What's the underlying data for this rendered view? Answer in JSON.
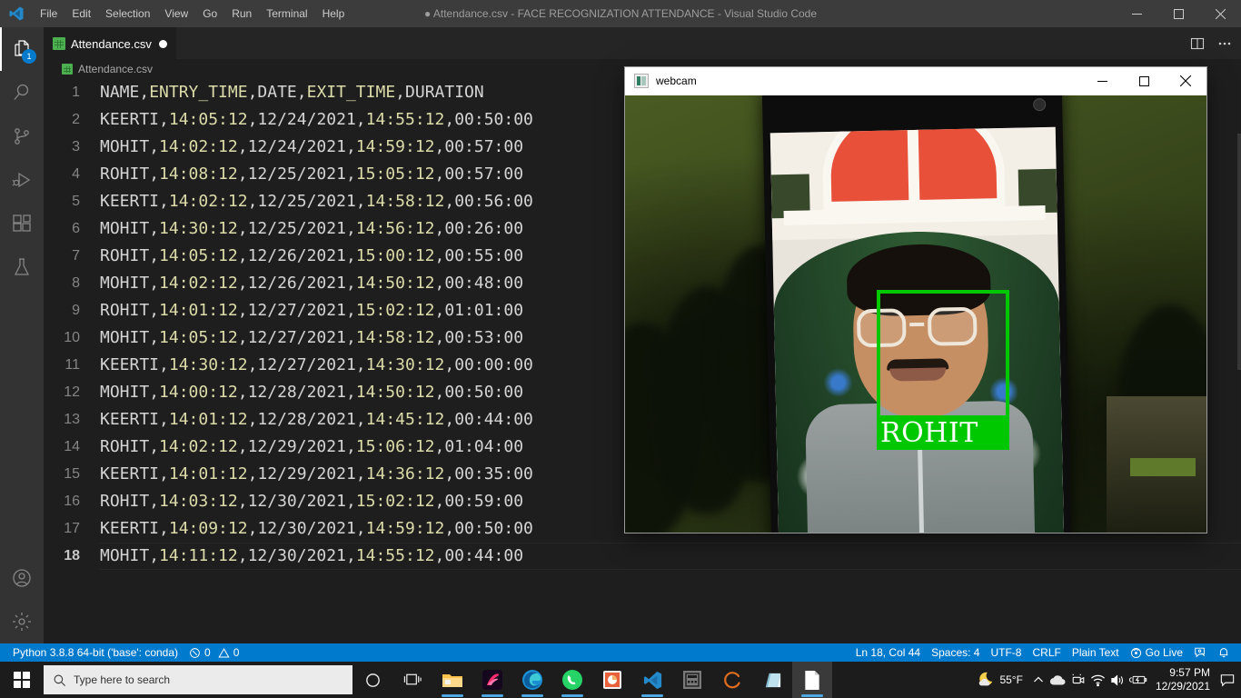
{
  "window": {
    "title": "● Attendance.csv - FACE RECOGNIZATION ATTENDANCE - Visual Studio Code",
    "minimize_label": "—",
    "maximize_label": "▢",
    "close_label": "✕"
  },
  "menubar": {
    "items": [
      "File",
      "Edit",
      "Selection",
      "View",
      "Go",
      "Run",
      "Terminal",
      "Help"
    ]
  },
  "activitybar": {
    "items": [
      {
        "name": "explorer",
        "badge": "1"
      },
      {
        "name": "search",
        "badge": ""
      },
      {
        "name": "source-control",
        "badge": ""
      },
      {
        "name": "run-and-debug",
        "badge": ""
      },
      {
        "name": "extensions",
        "badge": ""
      },
      {
        "name": "testing",
        "badge": ""
      }
    ],
    "bottom": [
      {
        "name": "accounts"
      },
      {
        "name": "manage-settings"
      }
    ]
  },
  "editor": {
    "tab": {
      "label": "Attendance.csv",
      "dirty": true
    },
    "breadcrumb": "Attendance.csv",
    "actions": {
      "split": "split-editor",
      "more": "..."
    },
    "lines": [
      {
        "n": "1",
        "text": "NAME,ENTRY_TIME,DATE,EXIT_TIME,DURATION"
      },
      {
        "n": "2",
        "text": "KEERTI,14:05:12,12/24/2021,14:55:12,00:50:00"
      },
      {
        "n": "3",
        "text": "MOHIT,14:02:12,12/24/2021,14:59:12,00:57:00"
      },
      {
        "n": "4",
        "text": "ROHIT,14:08:12,12/25/2021,15:05:12,00:57:00"
      },
      {
        "n": "5",
        "text": "KEERTI,14:02:12,12/25/2021,14:58:12,00:56:00"
      },
      {
        "n": "6",
        "text": "MOHIT,14:30:12,12/25/2021,14:56:12,00:26:00"
      },
      {
        "n": "7",
        "text": "ROHIT,14:05:12,12/26/2021,15:00:12,00:55:00"
      },
      {
        "n": "8",
        "text": "MOHIT,14:02:12,12/26/2021,14:50:12,00:48:00"
      },
      {
        "n": "9",
        "text": "ROHIT,14:01:12,12/27/2021,15:02:12,01:01:00"
      },
      {
        "n": "10",
        "text": "MOHIT,14:05:12,12/27/2021,14:58:12,00:53:00"
      },
      {
        "n": "11",
        "text": "KEERTI,14:30:12,12/27/2021,14:30:12,00:00:00"
      },
      {
        "n": "12",
        "text": "MOHIT,14:00:12,12/28/2021,14:50:12,00:50:00"
      },
      {
        "n": "13",
        "text": "KEERTI,14:01:12,12/28/2021,14:45:12,00:44:00"
      },
      {
        "n": "14",
        "text": "ROHIT,14:02:12,12/29/2021,15:06:12,01:04:00"
      },
      {
        "n": "15",
        "text": "KEERTI,14:01:12,12/29/2021,14:36:12,00:35:00"
      },
      {
        "n": "16",
        "text": "ROHIT,14:03:12,12/30/2021,15:02:12,00:59:00"
      },
      {
        "n": "17",
        "text": "KEERTI,14:09:12,12/30/2021,14:59:12,00:50:00"
      },
      {
        "n": "18",
        "text": "MOHIT,14:11:12,12/30/2021,14:55:12,00:44:00",
        "active": true
      }
    ]
  },
  "statusbar": {
    "python": "Python 3.8.8 64-bit ('base': conda)",
    "errors": "0",
    "warnings": "0",
    "position": "Ln 18, Col 44",
    "spaces": "Spaces: 4",
    "encoding": "UTF-8",
    "eol": "CRLF",
    "language": "Plain Text",
    "golive": "Go Live",
    "accent": "#007acc"
  },
  "webcam_window": {
    "title": "webcam",
    "minimize_label": "—",
    "maximize_label": "▢",
    "close_label": "✕",
    "detection": {
      "label": "ROHIT",
      "box_color": "#00c800",
      "label_text_color": "#ffffff"
    }
  },
  "taskbar": {
    "search_placeholder": "Type here to search",
    "apps": [
      {
        "name": "cortana"
      },
      {
        "name": "task-view"
      },
      {
        "name": "file-explorer"
      },
      {
        "name": "creative-app"
      },
      {
        "name": "microsoft-edge"
      },
      {
        "name": "whatsapp"
      },
      {
        "name": "powerpoint"
      },
      {
        "name": "visual-studio-code"
      },
      {
        "name": "calculator"
      },
      {
        "name": "anaconda-navigator"
      },
      {
        "name": "sticky-notes"
      },
      {
        "name": "python-window"
      }
    ],
    "tray": {
      "weather": "55°F",
      "time": "9:57 PM",
      "date": "12/29/2021"
    }
  }
}
